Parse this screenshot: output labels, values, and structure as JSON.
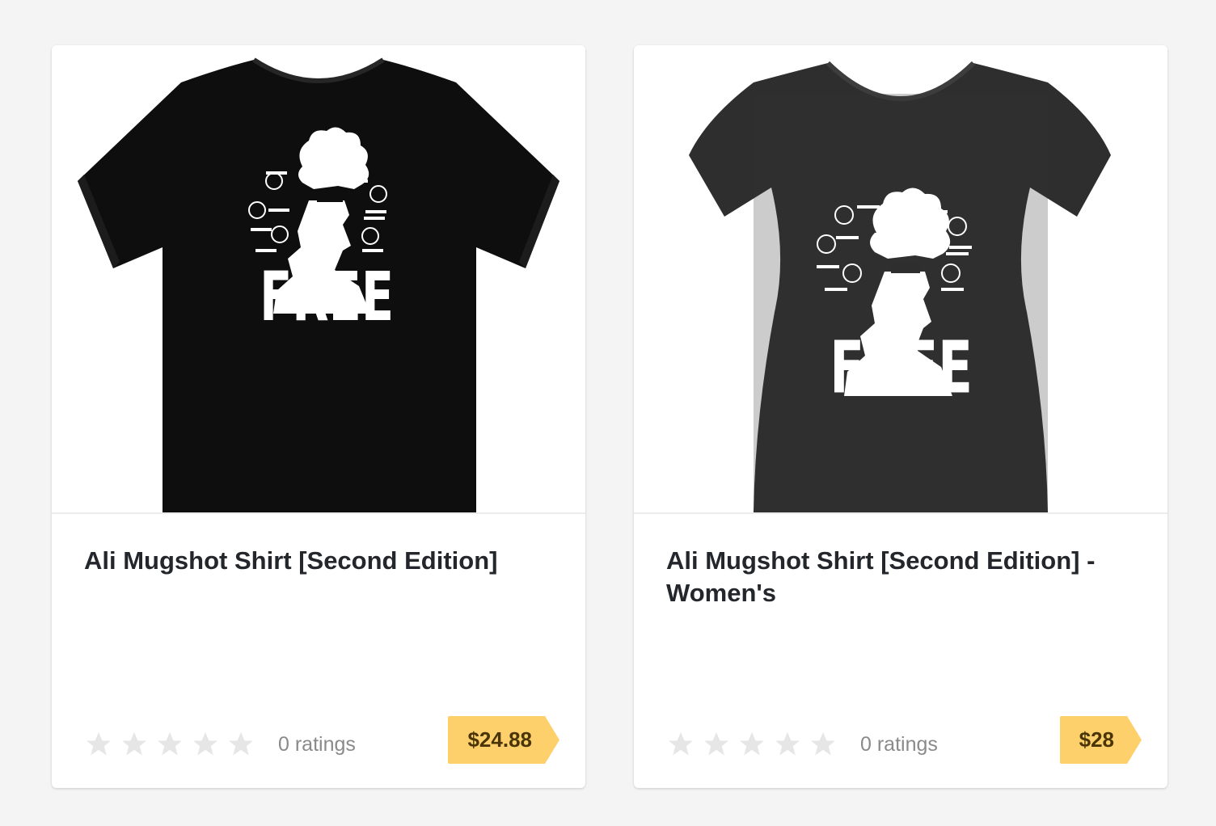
{
  "products": [
    {
      "title": "Ali Mugshot Shirt [Second Edition]",
      "image_icon": "black-tshirt-free-print",
      "rating_text": "0 ratings",
      "stars": 0,
      "price": "$24.88",
      "shirt_color": "#0e0e0e"
    },
    {
      "title": "Ali Mugshot Shirt [Second Edition] - Women's",
      "image_icon": "charcoal-womens-tshirt-free-print",
      "rating_text": "0 ratings",
      "stars": 0,
      "price": "$28",
      "shirt_color": "#2e2e2e"
    }
  ],
  "colors": {
    "page_bg": "#f4f4f4",
    "card_bg": "#ffffff",
    "price_tag": "#fdd06b",
    "price_text": "#4a3508",
    "title_text": "#23262b",
    "rating_text": "#8a8a8a",
    "star_empty": "#e6e6e6"
  }
}
